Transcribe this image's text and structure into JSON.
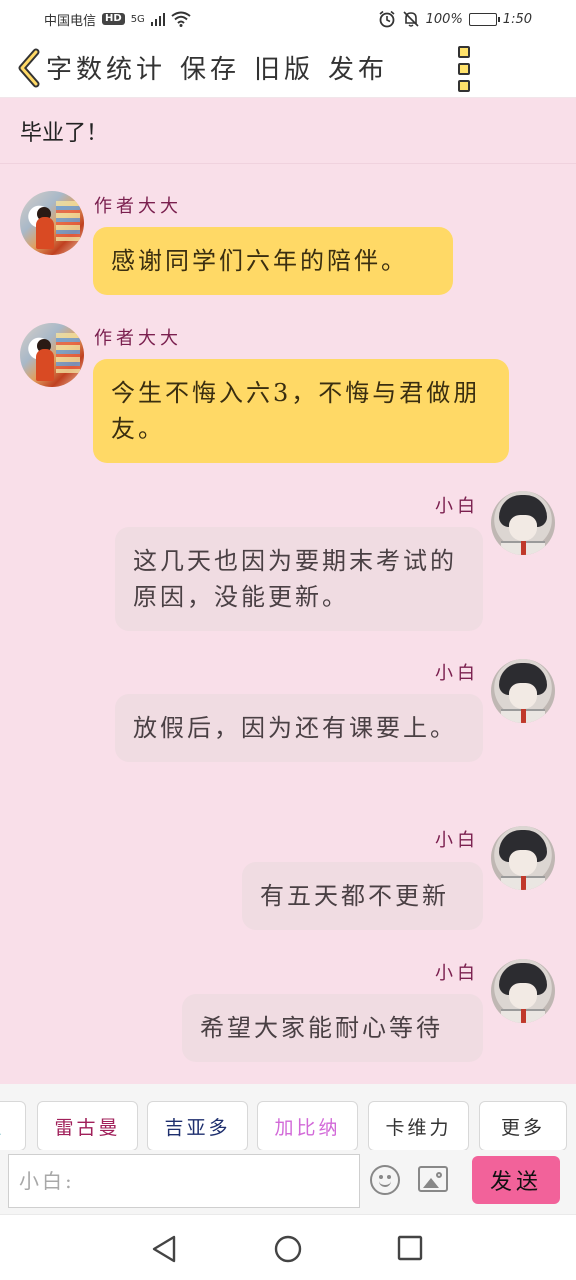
{
  "status_bar": {
    "carrier": "中国电信",
    "hd": "HD",
    "network": "5G",
    "battery": "100%",
    "time": "1:50"
  },
  "nav": {
    "word_count": "字数统计",
    "save": "保存",
    "old_version": "旧版",
    "publish": "发布"
  },
  "chat": {
    "title": "毕业了！"
  },
  "messages": [
    {
      "sender": "作者大大",
      "text": "感谢同学们六年的陪伴。"
    },
    {
      "sender": "作者大大",
      "text": "今生不悔入六3，不悔与君做朋友。"
    },
    {
      "sender": "小白",
      "text": "这几天也因为要期末考试的原因，没能更新。"
    },
    {
      "sender": "小白",
      "text": "放假后，因为还有课要上。"
    },
    {
      "sender": "小白",
      "text": "有五天都不更新"
    },
    {
      "sender": "小白",
      "text": "希望大家能耐心等待"
    }
  ],
  "chips": [
    {
      "label": "拉",
      "color": "#2a9aa8"
    },
    {
      "label": "雷古曼",
      "color": "#a0205a"
    },
    {
      "label": "吉亚多",
      "color": "#1e2f6e"
    },
    {
      "label": "加比纳",
      "color": "#d26ad8"
    },
    {
      "label": "卡维力",
      "color": "#333333"
    },
    {
      "label": "更多",
      "color": "#333333"
    }
  ],
  "input": {
    "placeholder": "小白:",
    "send": "发送"
  }
}
